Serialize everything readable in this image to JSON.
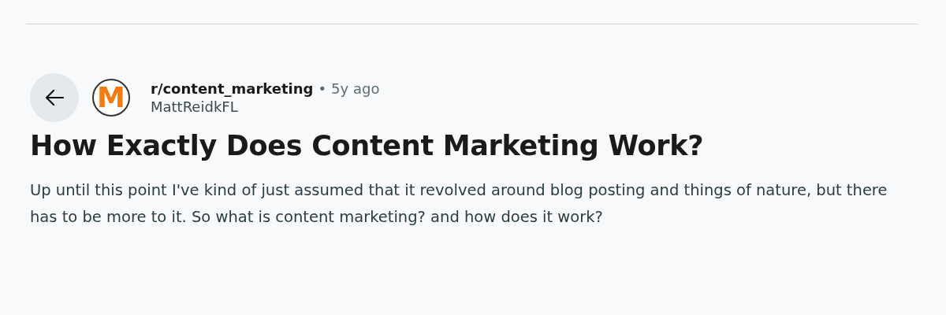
{
  "post": {
    "community": "r/content_marketing",
    "separator": "•",
    "age": "5y ago",
    "author": "MattReidkFL",
    "avatar_letter": "M",
    "title": "How Exactly Does Content Marketing Work?",
    "body": "Up until this point I've kind of just assumed that it revolved around blog posting and things of nature, but there has to be more to it. So what is content marketing? and how does it work?"
  }
}
